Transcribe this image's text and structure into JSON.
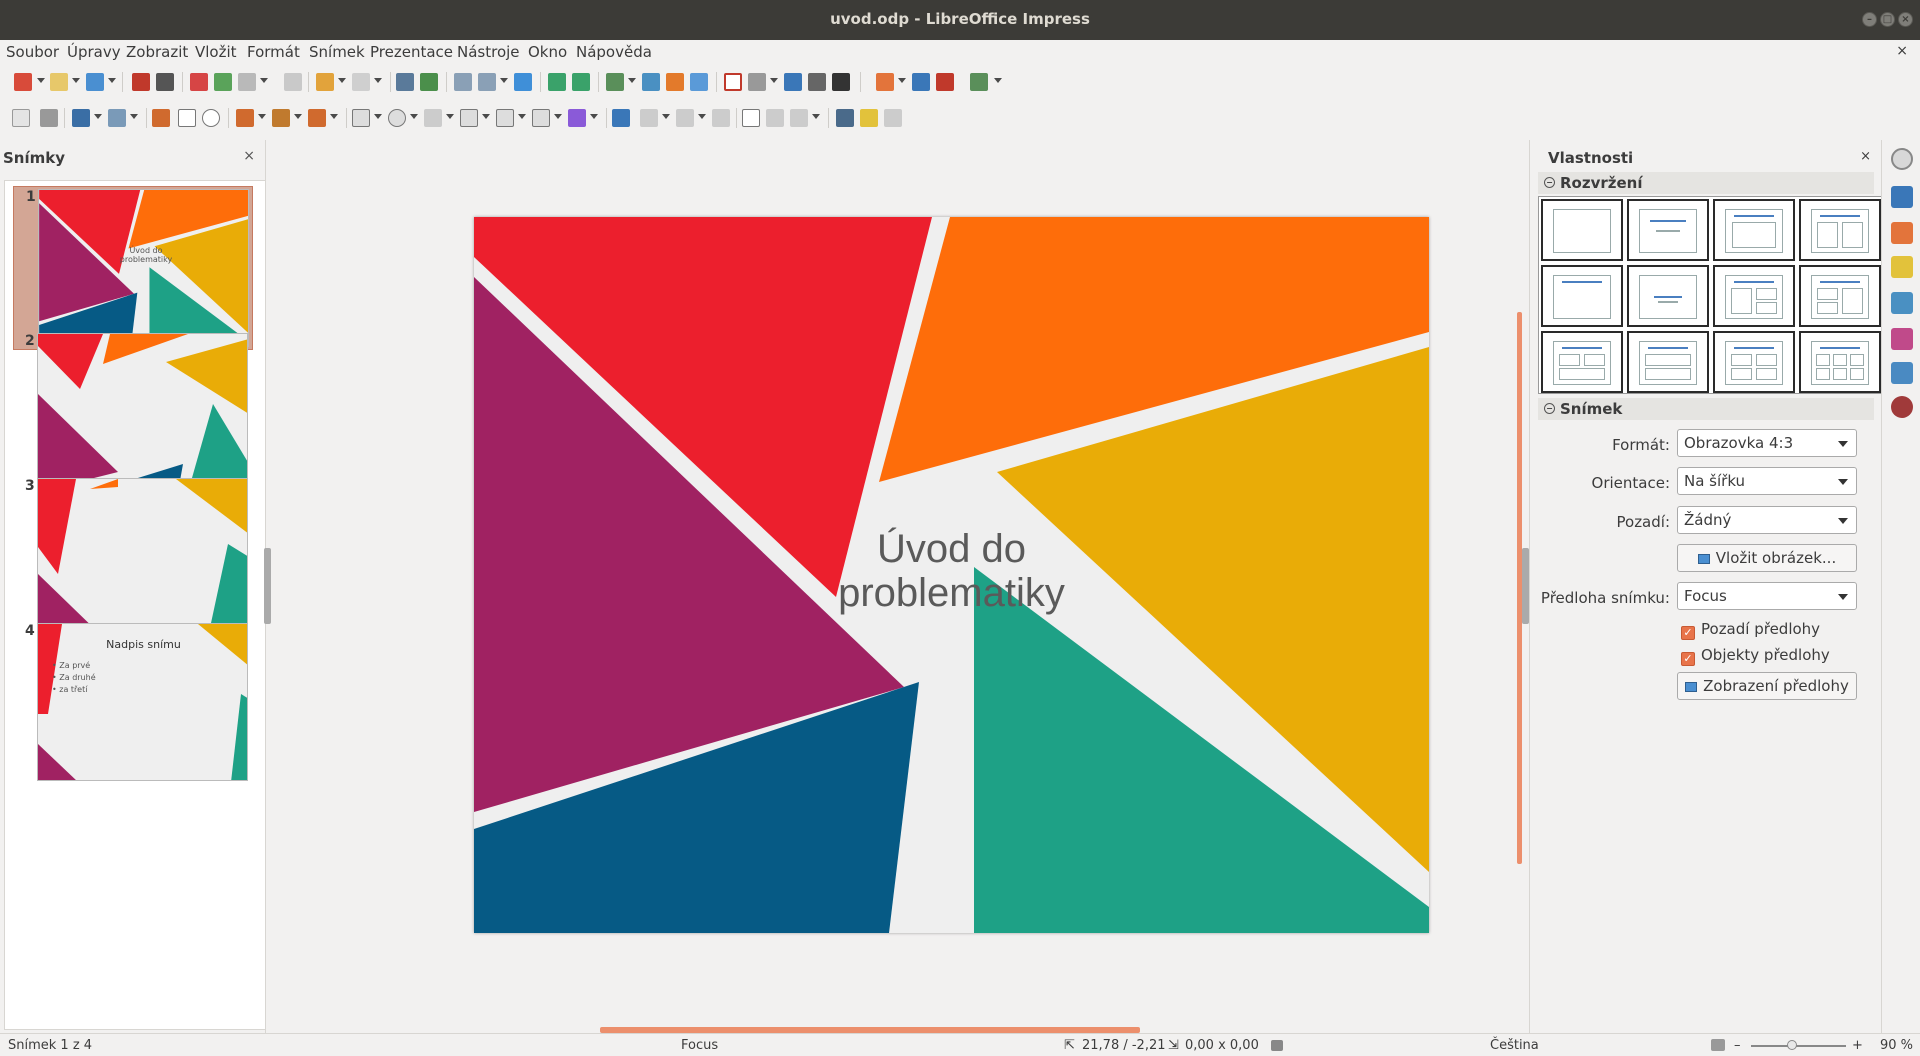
{
  "window": {
    "title": "uvod.odp - LibreOffice Impress",
    "close_glyph": "×"
  },
  "menu": {
    "items": [
      "Soubor",
      "Úpravy",
      "Zobrazit",
      "Vložit",
      "Formát",
      "Snímek",
      "Prezentace",
      "Nástroje",
      "Okno",
      "Nápověda"
    ],
    "close_glyph": "×"
  },
  "slides_panel": {
    "title": "Snímky",
    "close_glyph": "×",
    "thumbnails": [
      {
        "number": "1",
        "text": "Úvod do problematiky",
        "selected": true
      },
      {
        "number": "2",
        "text": "",
        "selected": false
      },
      {
        "number": "3",
        "text": "",
        "selected": false
      },
      {
        "number": "4",
        "title": "Nadpis snímu",
        "bullets": [
          "Za prvé",
          "Za druhé",
          "za třetí"
        ],
        "selected": false
      }
    ]
  },
  "slide": {
    "title_line1": "Úvod do",
    "title_line2": "problematiky",
    "colors": {
      "red": "#ec1f2d",
      "orange": "#fe6d0a",
      "yellow": "#e9ac07",
      "teal": "#1ea186",
      "blue": "#065a85",
      "purple": "#a02262",
      "background": "#efefef"
    }
  },
  "properties": {
    "title": "Vlastnosti",
    "close_glyph": "×",
    "layout_section": "Rozvržení",
    "slide_section": "Snímek",
    "format_label": "Formát:",
    "format_value": "Obrazovka 4:3",
    "orientation_label": "Orientace:",
    "orientation_value": "Na šířku",
    "background_label": "Pozadí:",
    "background_value": "Žádný",
    "insert_image_button": "Vložit obrázek...",
    "master_label": "Předloha snímku:",
    "master_value": "Focus",
    "master_background_check": "Pozadí předlohy",
    "master_objects_check": "Objekty předlohy",
    "show_master_button": "Zobrazení předlohy",
    "accent_color": "#e8744a"
  },
  "statusbar": {
    "slide_info": "Snímek 1 z 4",
    "master_name": "Focus",
    "position": "21,78 / -2,21",
    "size": "0,00 x 0,00",
    "language": "Čeština",
    "zoom": "90 %",
    "zoom_minus": "–",
    "zoom_plus": "+"
  }
}
